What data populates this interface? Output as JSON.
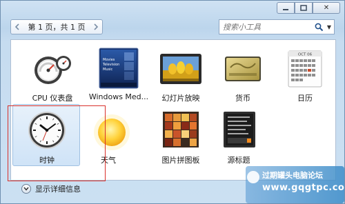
{
  "window": {
    "caption_buttons": {
      "minimize": "minimize-icon",
      "maximize": "maximize-icon",
      "close_label": "✕"
    }
  },
  "toolbar": {
    "pager_text": "第 1 页，共 1 页",
    "prev_icon": "chevron-left-icon",
    "next_icon": "chevron-right-icon",
    "search": {
      "placeholder": "搜索小工具",
      "value": ""
    }
  },
  "gadgets": [
    {
      "id": "cpu",
      "label": "CPU 仪表盘",
      "icon": "cpu-meter-icon"
    },
    {
      "id": "media",
      "label": "Windows Med...",
      "icon": "windows-media-center-icon",
      "tiles": [
        "Movies",
        "Television",
        "Music"
      ]
    },
    {
      "id": "slideshow",
      "label": "幻灯片放映",
      "icon": "slideshow-icon"
    },
    {
      "id": "currency",
      "label": "货币",
      "icon": "currency-icon"
    },
    {
      "id": "calendar",
      "label": "日历",
      "icon": "calendar-icon",
      "month": "OCT 06"
    },
    {
      "id": "clock",
      "label": "时钟",
      "icon": "clock-icon",
      "selected": true
    },
    {
      "id": "weather",
      "label": "天气",
      "icon": "weather-sun-icon"
    },
    {
      "id": "puzzle",
      "label": "图片拼图板",
      "icon": "picture-puzzle-icon"
    },
    {
      "id": "feed",
      "label": "源标题",
      "icon": "feed-headlines-icon"
    }
  ],
  "details": {
    "label": "显示详细信息"
  },
  "watermark": {
    "line1": "过期罐头电脑论坛",
    "line2": "www.gqgtpc.com"
  },
  "colors": {
    "selection": "#cfe3f7",
    "highlight_frame": "#d9302a",
    "window_bg": "#c9dff2"
  }
}
